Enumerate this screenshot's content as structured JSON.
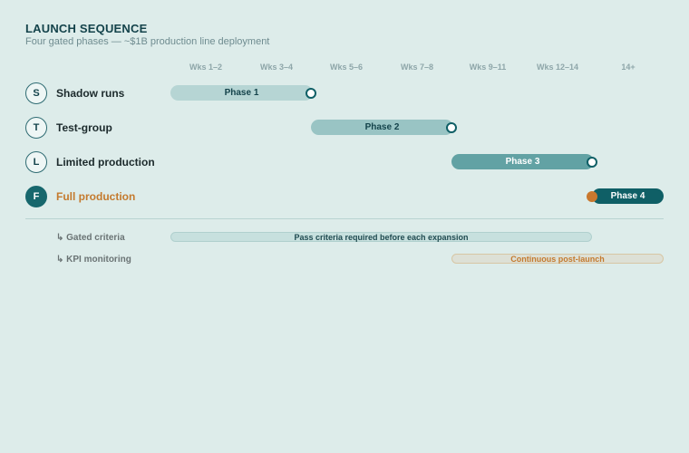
{
  "header": {
    "title": "LAUNCH SEQUENCE",
    "subtitle": "Four gated phases — ~$1B production line deployment"
  },
  "columns": [
    "Wks 1–2",
    "Wks 3–4",
    "Wks 5–6",
    "Wks 7–8",
    "Wks 9–11",
    "Wks 12–14",
    "14+"
  ],
  "phases": [
    {
      "letter": "S",
      "label": "Shadow runs",
      "bar_label": "Phase 1"
    },
    {
      "letter": "T",
      "label": "Test-group",
      "bar_label": "Phase 2"
    },
    {
      "letter": "L",
      "label": "Limited production",
      "bar_label": "Phase 3"
    },
    {
      "letter": "F",
      "label": "Full production",
      "bar_label": "Phase 4"
    }
  ],
  "tracks": [
    {
      "label": "↳ Gated criteria",
      "bar_label": "Pass criteria required before each expansion"
    },
    {
      "label": "↳ KPI monitoring",
      "bar_label": "Continuous post-launch"
    }
  ],
  "colors": {
    "background": "#ddecea",
    "primary": "#0f5f66",
    "accent": "#c9782e"
  }
}
